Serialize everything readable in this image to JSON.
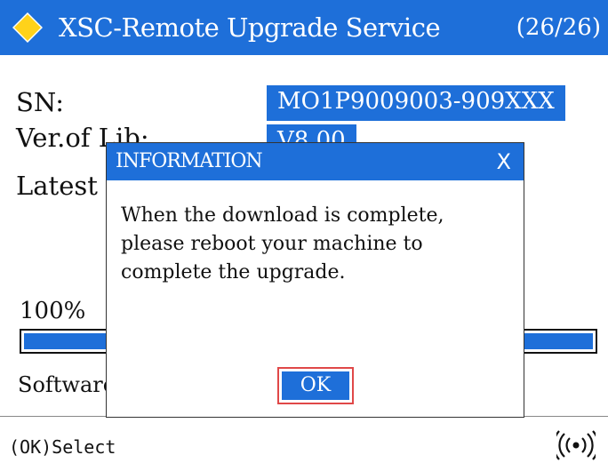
{
  "colors": {
    "accent": "#1e6fd9",
    "focus_border": "#e04848",
    "icon_yellow": "#ffd21a"
  },
  "header": {
    "icon": "yellow-diamond-icon",
    "title": "XSC-Remote Upgrade Service",
    "page_counter": "(26/26)"
  },
  "info": {
    "sn_label": "SN:",
    "sn_value": "MO1P9009003-909XXX",
    "version_label": "Ver.of Lib:",
    "version_value": "V8.00",
    "latest_label": "Latest"
  },
  "progress": {
    "percent_text": "100%",
    "value": 1.0,
    "status_label": "Software"
  },
  "dialog": {
    "title": "INFORMATION",
    "close_label": "X",
    "message_lines": [
      "When the download is complete,",
      "please reboot your machine to",
      "complete the upgrade."
    ],
    "ok_label": "OK"
  },
  "footer": {
    "hint": "(OK)Select",
    "signal_icon": "wireless-signal-icon"
  }
}
